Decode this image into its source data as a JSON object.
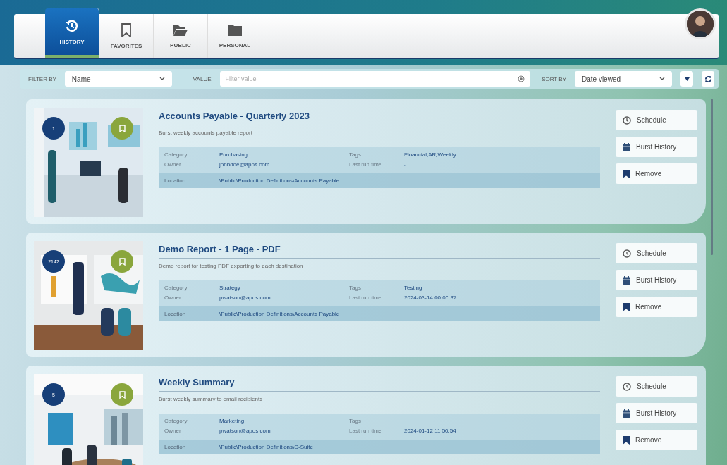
{
  "tabs": [
    {
      "label": "HISTORY",
      "selected": true
    },
    {
      "label": "FAVORITES",
      "selected": false
    },
    {
      "label": "PUBLIC",
      "selected": false
    },
    {
      "label": "PERSONAL",
      "selected": false
    }
  ],
  "filter_bar": {
    "filter_label": "FILTER BY",
    "filter_value": "Name",
    "value_label": "VALUE",
    "value_placeholder": "Filter value",
    "sort_label": "SORT BY",
    "sort_value": "Date viewed"
  },
  "reports": [
    {
      "badge": "1",
      "title": "Accounts Payable - Quarterly 2023",
      "description": "Burst weekly accounts payable report",
      "picture": {
        "kind": "picture"
      },
      "details": [
        {
          "label": "Category",
          "value": "Purchasing"
        },
        {
          "label": "Tags",
          "value": "Financial,AR,Weekly"
        },
        {
          "label": "Owner",
          "value": "johndoe@apos.com"
        },
        {
          "label": "Last run time",
          "value": "-"
        }
      ],
      "location": {
        "label": "Location",
        "value": "\\Public\\Production Definitions\\Accounts Payable"
      },
      "actions": [
        {
          "label": "Schedule",
          "kind": "schedule"
        },
        {
          "label": "Burst History",
          "kind": "history"
        },
        {
          "label": "Remove",
          "kind": "remove"
        }
      ]
    },
    {
      "badge": "2142",
      "title": "Demo Report - 1 Page - PDF",
      "description": "Demo report for testing PDF exporting to each destination",
      "picture": {
        "kind": "picture"
      },
      "details": [
        {
          "label": "Category",
          "value": "Strategy"
        },
        {
          "label": "Tags",
          "value": "Testing"
        },
        {
          "label": "Owner",
          "value": "pwatson@apos.com"
        },
        {
          "label": "Last run time",
          "value": "2024-03-14 00:00:37"
        }
      ],
      "location": {
        "label": "Location",
        "value": "\\Public\\Production Definitions\\Accounts Payable"
      },
      "actions": [
        {
          "label": "Schedule",
          "kind": "schedule"
        },
        {
          "label": "Burst History",
          "kind": "history"
        },
        {
          "label": "Remove",
          "kind": "remove"
        }
      ]
    },
    {
      "badge": "5",
      "title": "Weekly Summary",
      "description": "Burst weekly summary to email recipients",
      "picture": {
        "kind": "picture"
      },
      "details": [
        {
          "label": "Category",
          "value": "Marketing"
        },
        {
          "label": "Tags"
        },
        {
          "label": "Owner",
          "value": "pwatson@apos.com"
        },
        {
          "label": "Last run time",
          "value": "2024-01-12 11:50:54"
        }
      ],
      "location": {
        "label": "Location",
        "value": "\\Public\\Production Definitions\\C-Suite"
      },
      "actions": [
        {
          "label": "Schedule",
          "kind": "schedule"
        },
        {
          "label": "Burst History",
          "kind": "history"
        },
        {
          "label": "Remove",
          "kind": "remove"
        }
      ]
    }
  ]
}
